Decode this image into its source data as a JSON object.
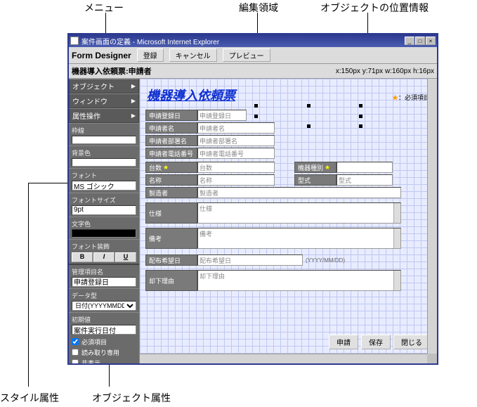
{
  "annotations": {
    "menu": "メニュー",
    "edit_area": "編集領域",
    "position_info": "オブジェクトの位置情報",
    "style_attr": "スタイル属性",
    "object_attr": "オブジェクト属性"
  },
  "titlebar": {
    "title": "案件画面の定義 - Microsoft Internet Explorer"
  },
  "toolbar": {
    "app_label": "Form Designer",
    "register": "登録",
    "cancel": "キャンセル",
    "preview": "プレビュー"
  },
  "infobar": {
    "breadcrumb": "機器導入依頼票:申請者",
    "position": "x:150px y:71px w:160px h:16px"
  },
  "menu": {
    "object": "オブジェクト",
    "window": "ウィンドウ",
    "attr_op": "属性操作"
  },
  "style": {
    "border_label": "枠線",
    "bg_label": "背景色",
    "font_label": "フォント",
    "font_value": "MS ゴシック",
    "fontsize_label": "フォントサイズ",
    "fontsize_value": "9pt",
    "color_label": "文字色",
    "decoration_label": "フォント装飾",
    "bold": "B",
    "italic": "I",
    "underline": "U"
  },
  "objattr": {
    "name_label": "管理項目名",
    "name_value": "申請登録日",
    "datatype_label": "データ型",
    "datatype_value": "日付(YYYYMMDD)",
    "default_label": "初期値",
    "default_value": "案件実行日付",
    "required": "必須項目",
    "readonly": "読み取り専用",
    "hidden": "非表示"
  },
  "form": {
    "title": "機器導入依頼票",
    "required_legend_star": "★",
    "required_legend": "：必須項目",
    "fields": {
      "reg_date": {
        "label": "申請登録日",
        "placeholder": "申請登録日"
      },
      "applicant": {
        "label": "申請者名",
        "placeholder": "申請者名"
      },
      "dept": {
        "label": "申請者部署名",
        "placeholder": "申請者部署名"
      },
      "phone": {
        "label": "申請者電話番号",
        "placeholder": "申請者電話番号"
      },
      "qty": {
        "label": "台数",
        "placeholder": "台数"
      },
      "device_type": {
        "label": "機器種別",
        "placeholder": ""
      },
      "name": {
        "label": "名称",
        "placeholder": "名称"
      },
      "model": {
        "label": "型式",
        "placeholder": "型式"
      },
      "maker": {
        "label": "製造者",
        "placeholder": "製造者"
      },
      "spec": {
        "label": "仕様",
        "placeholder": "仕様"
      },
      "remarks": {
        "label": "備考",
        "placeholder": "備考"
      },
      "dist_date": {
        "label": "配布希望日",
        "placeholder": "配布希望日",
        "hint": "(YYYY/MM/DD)"
      },
      "reject": {
        "label": "却下理由",
        "placeholder": "却下理由"
      }
    },
    "buttons": {
      "apply": "申請",
      "save": "保存",
      "close": "閉じる"
    }
  }
}
